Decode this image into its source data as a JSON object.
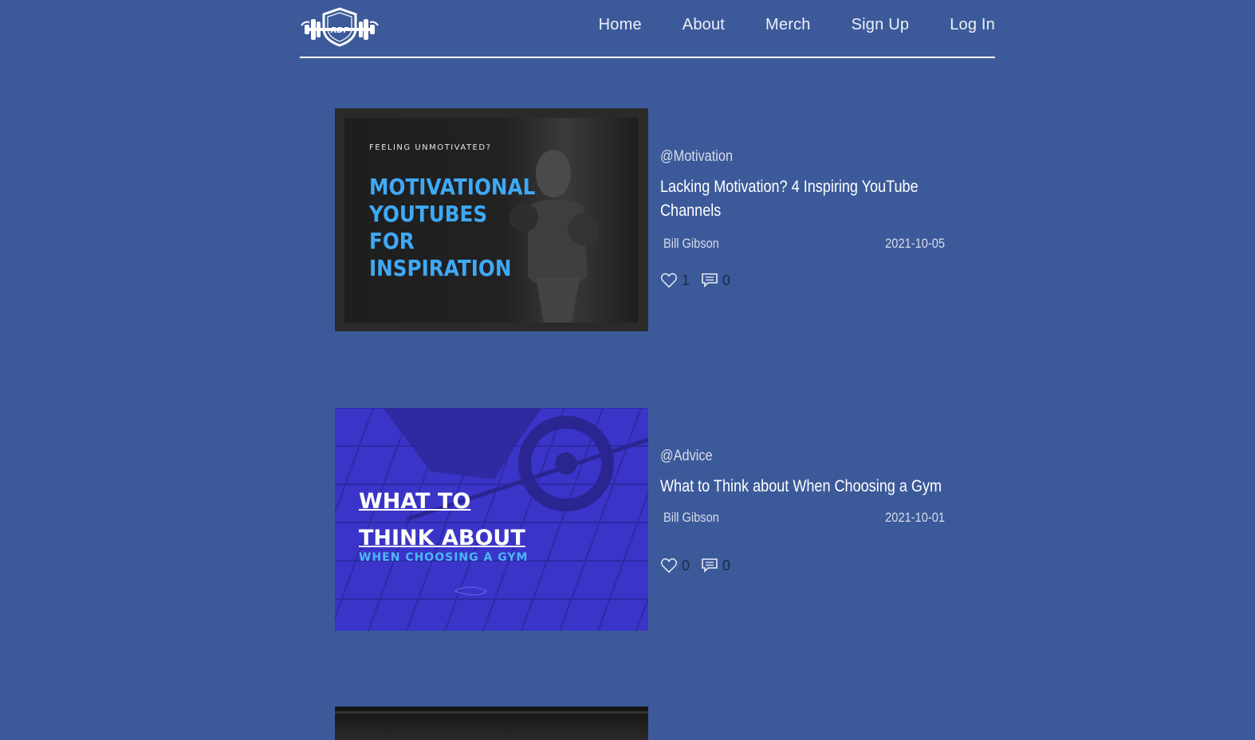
{
  "brand": {
    "logo_text": "RDF"
  },
  "nav": {
    "items": [
      "Home",
      "About",
      "Merch",
      "Sign Up",
      "Log In"
    ]
  },
  "posts": [
    {
      "thumbnail": {
        "kicker": "FEELING UNMOTIVATED?",
        "headline_lines": [
          "MOTIVATIONAL",
          "YOUTUBES",
          "FOR",
          "INSPIRATION"
        ]
      },
      "tag": "@Motivation",
      "title": "Lacking Motivation? 4 Inspiring YouTube Channels",
      "author": "Bill Gibson",
      "date": "2021-10-05",
      "likes": "1",
      "comments": "0"
    },
    {
      "thumbnail": {
        "headline_lines": [
          "WHAT TO",
          "THINK ABOUT"
        ],
        "subline": "WHEN CHOOSING A GYM"
      },
      "tag": "@Advice",
      "title": "What to Think about When Choosing a Gym",
      "author": "Bill Gibson",
      "date": "2021-10-01",
      "likes": "0",
      "comments": "0"
    }
  ],
  "icons": {
    "like": "heart-icon",
    "comment": "comment-icon"
  },
  "colors": {
    "page_bg": "#3c5a9a",
    "thumb1_accent": "#3fa9f5",
    "thumb2_bg": "#3a35c8"
  }
}
